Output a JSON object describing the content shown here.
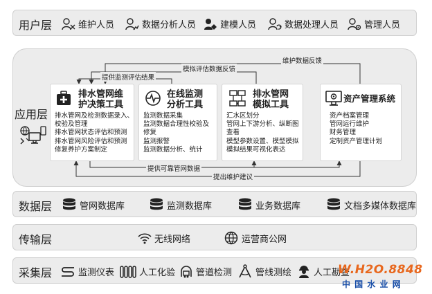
{
  "user_layer": {
    "title": "用户层",
    "items": [
      "维护人员",
      "数据分析人员",
      "建模人员",
      "数据处理人员",
      "管理人员"
    ]
  },
  "app_layer": {
    "title": "应用层",
    "cards": [
      {
        "title_lines": [
          "排水管网维",
          "护决策工具"
        ],
        "lines": [
          "排水管网及检测数据录入、",
          "校验及管理",
          "排水管网状态评估和预测",
          "排水管网风险评估和预测",
          "修复养护方案制定"
        ]
      },
      {
        "title_lines": [
          "在线监测",
          "分析工具"
        ],
        "lines": [
          "监测数据采集",
          "监测数据合理性校验及",
          "修复",
          "监测报警",
          "监测数据分析、统计"
        ]
      },
      {
        "title_lines": [
          "排水管网",
          "模拟工具"
        ],
        "lines": [
          "汇水区划分",
          "管网上下游分析、纵断图",
          "查看",
          "模型参数设置、模型模拟",
          "模拟结果可视化表达"
        ]
      },
      {
        "title_lines": [
          "资产管理系统"
        ],
        "lines": [
          "资产档案管理",
          "管网运行维护",
          "财务管理",
          "定制资产管理计划"
        ]
      }
    ],
    "flows": {
      "maintenance_feedback": "维护数据反馈",
      "sim_feedback": "模拟评估数据反馈",
      "monitoring_results": "提供监测评估结果",
      "reliable_data": "提供可靠管网数据",
      "maintenance_suggestions": "提出维护建议"
    }
  },
  "data_layer": {
    "title": "数据层",
    "items": [
      "管网数据库",
      "监测数据库",
      "业务数据库",
      "文档多媒体数据库"
    ]
  },
  "transport_layer": {
    "title": "传输层",
    "items": [
      "无线网络",
      "运营商公网"
    ]
  },
  "collect_layer": {
    "title": "采集层",
    "items": [
      "监测仪表",
      "人工化验",
      "管道检测",
      "管线测绘",
      "人工勘查"
    ]
  },
  "watermark": {
    "top": "W.H2O.8848",
    "bottom": "中 国 水 业 网"
  }
}
